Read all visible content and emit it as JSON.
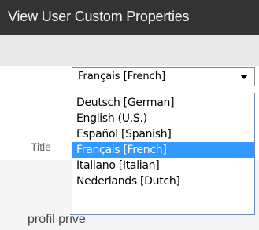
{
  "header": {
    "title": "View User Custom Properties"
  },
  "language_select": {
    "selected": "Français [French]",
    "options": [
      "Deutsch [German]",
      "English (U.S.)",
      "Español [Spanish]",
      "Français [French]",
      "Italiano [Italian]",
      "Nederlands [Dutch]"
    ],
    "selected_index": 3
  },
  "form": {
    "title_label": "Title"
  },
  "profile": {
    "text": "profil prive"
  },
  "colors": {
    "header_bar": "#333333",
    "selection": "#3399ff"
  },
  "icons": {
    "dropdown": "chevron-down-icon"
  }
}
